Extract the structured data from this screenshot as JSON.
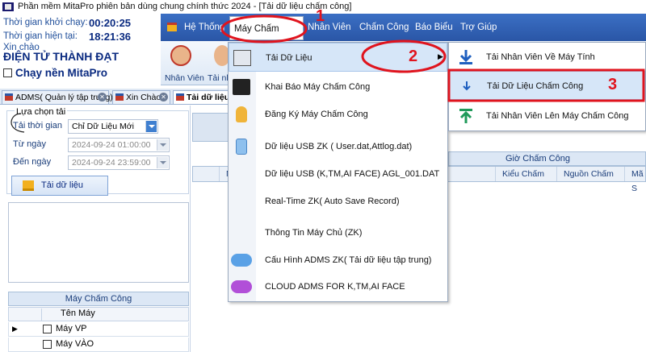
{
  "window": {
    "title": "Phần mềm MitaPro phiên bản dùng chung chính thức 2024 - [Tải dữ liệu chấm công]"
  },
  "info": {
    "start_label": "Thời gian khởi chạy:",
    "start_value": "00:20:25",
    "now_label": "Thời gian hiện tại:",
    "now_value": "18:21:36",
    "greeting": "Xin chào",
    "company": "ĐIỆN TỬ THÀNH ĐẠT",
    "background_run": "Chạy nền MitaPro"
  },
  "menubar": {
    "items": [
      "Hệ Thống",
      "Máy Chấm Công",
      "Nhân Viên",
      "Chấm Công",
      "Báo Biểu",
      "Trợ Giúp"
    ]
  },
  "ribbon": {
    "employee_label": "Nhân Viên",
    "download_label_partial": "Tải nh"
  },
  "tabs": [
    {
      "label": "ADMS( Quản lý tập trung)"
    },
    {
      "label": "Xin Chào"
    },
    {
      "label": "Tải dữ liệu c"
    }
  ],
  "left_panel": {
    "group_title": "Lựa chọn tải",
    "time_label": "Tải thời gian",
    "time_value": "Chỉ Dữ Liệu Mới",
    "from_label": "Từ ngày",
    "from_value": "2024-09-24 01:00:00",
    "to_label": "Đến ngày",
    "to_value": "2024-09-24 23:59:00",
    "load_button": "Tải dữ liệu",
    "machines_title": "Máy Chấm Công",
    "machines_col": "Tên Máy",
    "machines": [
      "Máy VP",
      "Máy VÀO"
    ]
  },
  "grid": {
    "group_header": "Giờ Chấm Công",
    "columns": [
      "M",
      "Kiểu Chấm",
      "Nguồn Chấm",
      "Mã S"
    ]
  },
  "dropdown": {
    "items": [
      {
        "label": "Tải Dữ Liệu",
        "icon": "download-db-icon"
      },
      {
        "label": "Khai Báo Máy Chấm Công",
        "icon": "machine-icon"
      },
      {
        "label": "Đăng Ký Máy Chấm Công",
        "icon": "key-icon"
      },
      {
        "label": "Dữ liệu USB ZK ( User.dat,Attlog.dat)",
        "icon": "usb-icon"
      },
      {
        "label": "Dữ liệu USB (K,TM,AI FACE) AGL_001.DAT",
        "icon": ""
      },
      {
        "label": "Real-Time ZK( Auto Save Record)",
        "icon": ""
      },
      {
        "label": "Thông Tin Máy Chủ (ZK)",
        "icon": ""
      },
      {
        "label": "Cấu Hình ADMS ZK( Tải dữ liệu tập trung)",
        "icon": "cloud-download-icon"
      },
      {
        "label": "CLOUD ADMS FOR K,TM,AI FACE",
        "icon": "cloud-icon"
      }
    ]
  },
  "submenu": {
    "items": [
      {
        "label": "Tải Nhân Viên Về Máy Tính",
        "icon": "arrow-down-icon"
      },
      {
        "label": "Tải Dữ Liệu Chấm Công",
        "icon": "arrow-down-icon"
      },
      {
        "label": "Tải Nhân Viên Lên Máy Chấm Công",
        "icon": "arrow-up-icon"
      }
    ]
  },
  "annotations": {
    "step1": "1",
    "step2": "2",
    "step3": "3"
  },
  "colors": {
    "annotation": "#e0141e",
    "menubar": "#2a56a6",
    "highlight": "#d6e6f8"
  }
}
